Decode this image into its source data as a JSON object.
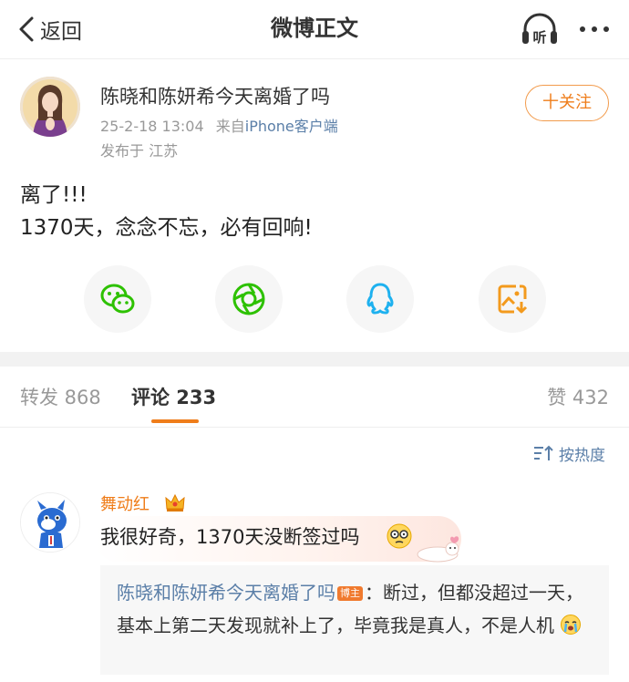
{
  "header": {
    "back_label": "返回",
    "title": "微博正文",
    "listen_label": "听"
  },
  "post": {
    "author": "陈晓和陈妍希今天离婚了吗",
    "time": "25-2-18 13:04",
    "source_prefix": "来自",
    "source": "iPhone客户端",
    "location": "发布于 江苏",
    "follow_label": "十关注",
    "text_line1": "离了!!!",
    "text_line2": "1370天，念念不忘，必有回响!"
  },
  "share_icons": [
    "wechat-icon",
    "moments-icon",
    "qq-icon",
    "save-image-icon"
  ],
  "tabs": {
    "repost": "转发 868",
    "comment": "评论 233",
    "like": "赞 432"
  },
  "sort_label": "按热度",
  "comment": {
    "author": "舞动红",
    "text": "我很好奇，1370天没断签过吗",
    "reply": {
      "author": "陈晓和陈妍希今天离婚了吗",
      "badge": "博主",
      "text": "：断过，但都没超过一天，基本上第二天发现就补上了，毕竟我是真人，不是人机"
    }
  },
  "colors": {
    "accent": "#ef7d1a",
    "link": "#5b7fa8",
    "muted": "#999999"
  }
}
